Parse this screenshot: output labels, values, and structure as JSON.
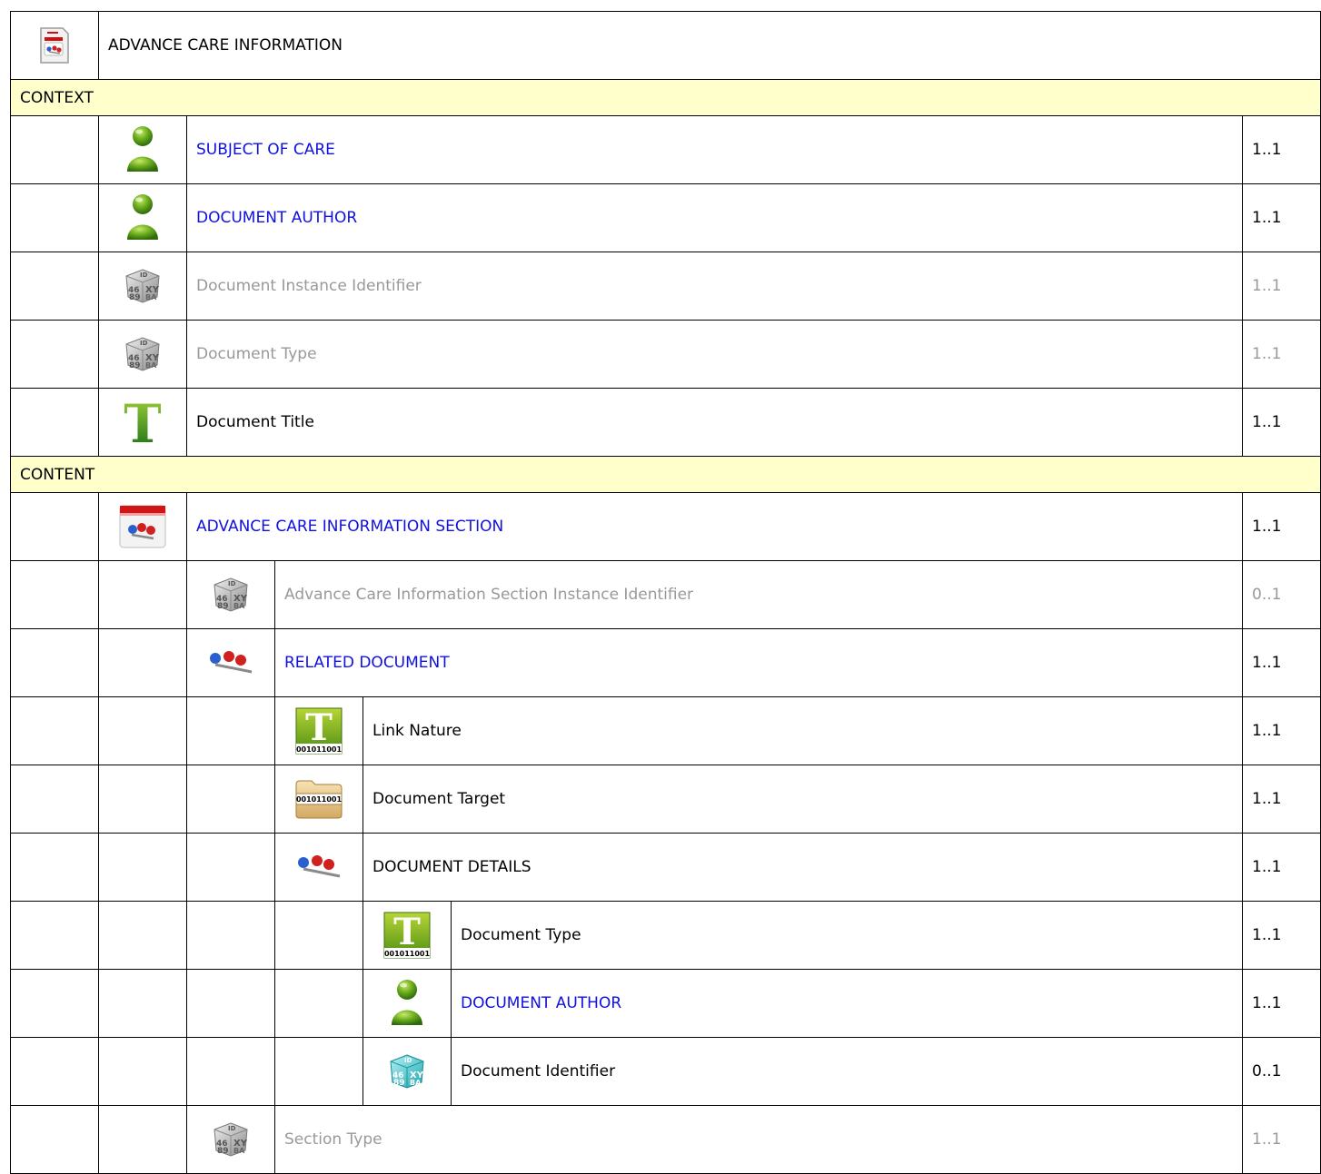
{
  "header": {
    "title": "ADVANCE CARE INFORMATION",
    "icon": "document-section-icon"
  },
  "sections": {
    "context": "CONTEXT",
    "content": "CONTENT"
  },
  "rows": [
    {
      "name": "SUBJECT OF CARE",
      "card": "1..1",
      "icon": "person-icon",
      "style": "link"
    },
    {
      "name": "DOCUMENT AUTHOR",
      "card": "1..1",
      "icon": "person-icon",
      "style": "link"
    },
    {
      "name": "Document Instance Identifier",
      "card": "1..1",
      "icon": "identifier-cube-icon",
      "style": "grey"
    },
    {
      "name": "Document Type",
      "card": "1..1",
      "icon": "identifier-cube-icon",
      "style": "grey"
    },
    {
      "name": "Document Title",
      "card": "1..1",
      "icon": "text-icon",
      "style": "normal"
    },
    {
      "name": "ADVANCE CARE INFORMATION SECTION",
      "card": "1..1",
      "icon": "section-icon",
      "style": "link"
    },
    {
      "name": "Advance Care Information Section Instance Identifier",
      "card": "0..1",
      "icon": "identifier-cube-icon",
      "style": "grey"
    },
    {
      "name": "RELATED DOCUMENT",
      "card": "1..1",
      "icon": "link-molecule-icon",
      "style": "link"
    },
    {
      "name": "Link Nature",
      "card": "1..1",
      "icon": "coded-text-icon",
      "style": "normal"
    },
    {
      "name": "Document Target",
      "card": "1..1",
      "icon": "binary-folder-icon",
      "style": "normal"
    },
    {
      "name": "DOCUMENT DETAILS",
      "card": "1..1",
      "icon": "link-molecule-icon",
      "style": "normal"
    },
    {
      "name": "Document Type",
      "card": "1..1",
      "icon": "coded-text-icon",
      "style": "normal"
    },
    {
      "name": "DOCUMENT AUTHOR",
      "card": "1..1",
      "icon": "person-icon",
      "style": "link"
    },
    {
      "name": "Document Identifier",
      "card": "0..1",
      "icon": "identifier-cube-teal-icon",
      "style": "normal"
    },
    {
      "name": "Section Type",
      "card": "1..1",
      "icon": "identifier-cube-icon",
      "style": "grey"
    }
  ],
  "icon_texts": {
    "binary": "001011001",
    "id": "ID",
    "cube_digits": "46 89",
    "cube_letters": "XY BA",
    "t": "T"
  },
  "colors": {
    "section_bg": "#ffffcc",
    "link": "#1010e0",
    "grey_text": "#999999"
  }
}
